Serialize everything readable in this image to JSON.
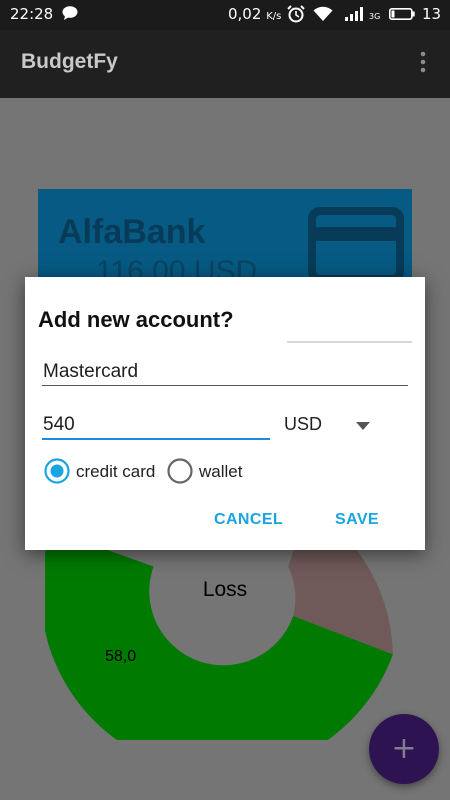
{
  "status_bar": {
    "time": "22:28",
    "network_speed": "0,02",
    "network_speed_unit": "K/s",
    "signal_type": "3G",
    "battery_level": "13"
  },
  "app_bar": {
    "title": "BudgetFy"
  },
  "background": {
    "account_card": {
      "bank_name": "AlfaBank",
      "balance": "116,00 USD",
      "color": "#0b78ad"
    },
    "chart_center_label": "Loss",
    "chart_slice_label": "58,0",
    "chart_colors": {
      "green": "#007a00",
      "red": "#6f5959"
    }
  },
  "dialog": {
    "title": "Add new account?",
    "account_name": "Mastercard",
    "amount": "540",
    "currency": "USD",
    "account_types": [
      "credit card",
      "wallet"
    ],
    "selected_account_type": "credit card",
    "cancel_label": "CANCEL",
    "save_label": "SAVE",
    "accent_color": "#1aa4e0"
  },
  "fab": {
    "icon": "plus-icon",
    "label": "+"
  }
}
